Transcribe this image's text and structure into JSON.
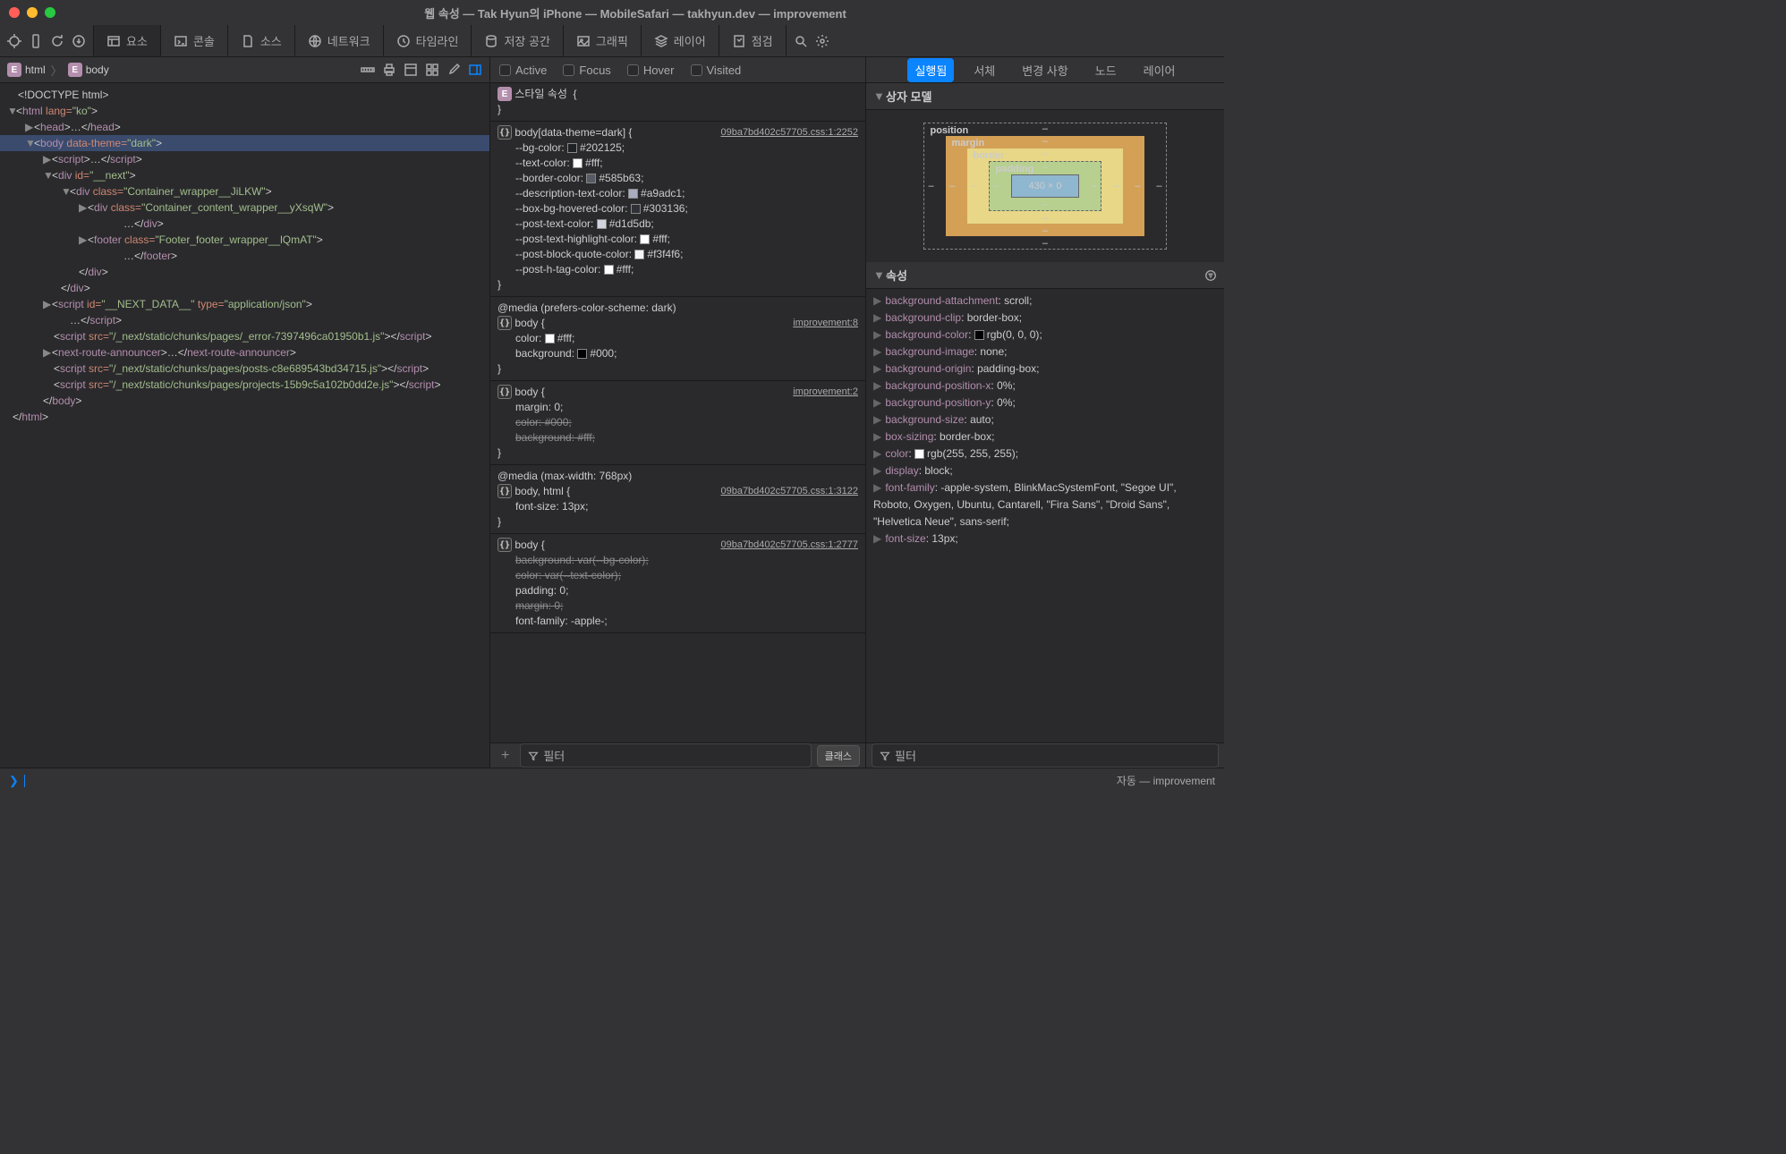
{
  "title": "웹 속성 — Tak Hyun의 iPhone — MobileSafari — takhyun.dev — improvement",
  "tabs": {
    "elements": "요소",
    "console": "콘솔",
    "sources": "소스",
    "network": "네트워크",
    "timeline": "타임라인",
    "storage": "저장 공간",
    "graphics": "그래픽",
    "layers": "레이어",
    "audit": "점검"
  },
  "breadcrumb": {
    "root": "html",
    "child": "body",
    "badge": "E"
  },
  "pseudo": {
    "active": "Active",
    "focus": "Focus",
    "hover": "Hover",
    "visited": "Visited"
  },
  "dom": {
    "doctype": "<!DOCTYPE html>",
    "html_open": "html",
    "html_lang_attr": "lang=",
    "html_lang_val": "\"ko\"",
    "head": "head",
    "head_dots": "…",
    "body": "body",
    "body_attr": "data-theme=",
    "body_val": "\"dark\"",
    "script": "script",
    "script_dots": "…",
    "div": "div",
    "id_attr": "id=",
    "next_val": "\"__next\"",
    "class_attr": "class=",
    "wrapper_val": "\"Container_wrapper__JiLKW\"",
    "content_val": "\"Container_content_wrapper__yXsqW\"",
    "content_dots": "…",
    "footer": "footer",
    "footer_val": "\"Footer_footer_wrapper__lQmAT\"",
    "nextdata_id": "\"__NEXT_DATA__\"",
    "type_attr": "type=",
    "type_val": "\"application/json\"",
    "nextdata_dots": "…",
    "src_attr": "src=",
    "err_src": "\"/_next/static/chunks/pages/_error-7397496ca01950b1.js\"",
    "announcer": "next-route-announcer",
    "announcer_dots": "…",
    "posts_src": "\"/_next/static/chunks/pages/posts-c8e689543bd34715.js\"",
    "proj_src": "\"/_next/static/chunks/pages/projects-15b9c5a102b0dd2e.js\"",
    "body_close": "body",
    "html_close": "html"
  },
  "styles": {
    "attr_title": "스타일 속성",
    "r1": {
      "sel": "body[data-theme=dark]",
      "link": "09ba7bd402c57705.css:1:2252",
      "p": [
        {
          "k": "--bg-color",
          "v": "#202125",
          "sw": "#202125"
        },
        {
          "k": "--text-color",
          "v": "#fff",
          "sw": "#fff"
        },
        {
          "k": "--border-color",
          "v": "#585b63",
          "sw": "#585b63"
        },
        {
          "k": "--description-text-color",
          "v": "#a9adc1",
          "sw": "#a9adc1"
        },
        {
          "k": "--box-bg-hovered-color",
          "v": "#303136",
          "sw": "#303136"
        },
        {
          "k": "--post-text-color",
          "v": "#d1d5db",
          "sw": "#d1d5db"
        },
        {
          "k": "--post-text-highlight-color",
          "v": "#fff",
          "sw": "#fff"
        },
        {
          "k": "--post-block-quote-color",
          "v": "#f3f4f6",
          "sw": "#f3f4f6"
        },
        {
          "k": "--post-h-tag-color",
          "v": "#fff",
          "sw": "#fff"
        }
      ]
    },
    "media1": "@media (prefers-color-scheme: dark)",
    "r2": {
      "sel": "body",
      "link": "improvement:8",
      "p": [
        {
          "k": "color",
          "v": "#fff",
          "sw": "#fff"
        },
        {
          "k": "background",
          "v": "#000",
          "sw": "#000"
        }
      ]
    },
    "r3": {
      "sel": "body",
      "link": "improvement:2",
      "p": [
        {
          "k": "margin",
          "v": "0"
        },
        {
          "k": "color",
          "v": "#000",
          "strike": true
        },
        {
          "k": "background",
          "v": "#fff",
          "strike": true
        }
      ]
    },
    "media2": "@media (max-width: 768px)",
    "r4": {
      "sel": "body, html",
      "link": "09ba7bd402c57705.css:1:3122",
      "p": [
        {
          "k": "font-size",
          "v": "13px"
        }
      ]
    },
    "r5": {
      "sel": "body",
      "link": "09ba7bd402c57705.css:1:2777",
      "p": [
        {
          "k": "background",
          "v": "var(--bg-color)",
          "strike": true
        },
        {
          "k": "color",
          "v": "var(--text-color)",
          "strike": true
        },
        {
          "k": "padding",
          "v": "0"
        },
        {
          "k": "margin",
          "v": "0",
          "strike": true
        },
        {
          "k": "font-family",
          "v": "-apple-"
        }
      ]
    }
  },
  "side": {
    "tabs": {
      "computed": "실행됨",
      "fonts": "서체",
      "changes": "변경 사항",
      "node": "노드",
      "layer": "레이어"
    },
    "box_title": "상자 모델",
    "box": {
      "position": "position",
      "margin": "margin",
      "border": "border",
      "padding": "padding",
      "content": "430 × 0",
      "dash": "–"
    },
    "props_title": "속성",
    "props": [
      {
        "k": "background-attachment",
        "v": "scroll"
      },
      {
        "k": "background-clip",
        "v": "border-box"
      },
      {
        "k": "background-color",
        "v": "rgb(0, 0, 0)",
        "sw": "#000"
      },
      {
        "k": "background-image",
        "v": "none"
      },
      {
        "k": "background-origin",
        "v": "padding-box"
      },
      {
        "k": "background-position-x",
        "v": "0%"
      },
      {
        "k": "background-position-y",
        "v": "0%"
      },
      {
        "k": "background-size",
        "v": "auto"
      },
      {
        "k": "box-sizing",
        "v": "border-box"
      },
      {
        "k": "color",
        "v": "rgb(255, 255, 255)",
        "sw": "#fff"
      },
      {
        "k": "display",
        "v": "block"
      },
      {
        "k": "font-family",
        "v": "-apple-system, BlinkMacSystemFont, \"Segoe UI\", Roboto, Oxygen, Ubuntu, Cantarell, \"Fira Sans\", \"Droid Sans\", \"Helvetica Neue\", sans-serif"
      },
      {
        "k": "font-size",
        "v": "13px"
      }
    ]
  },
  "filter": {
    "label": "필터",
    "classes_btn": "클래스",
    "plus": "+"
  },
  "console": {
    "prompt": "❯",
    "status": "자동 — improvement"
  }
}
